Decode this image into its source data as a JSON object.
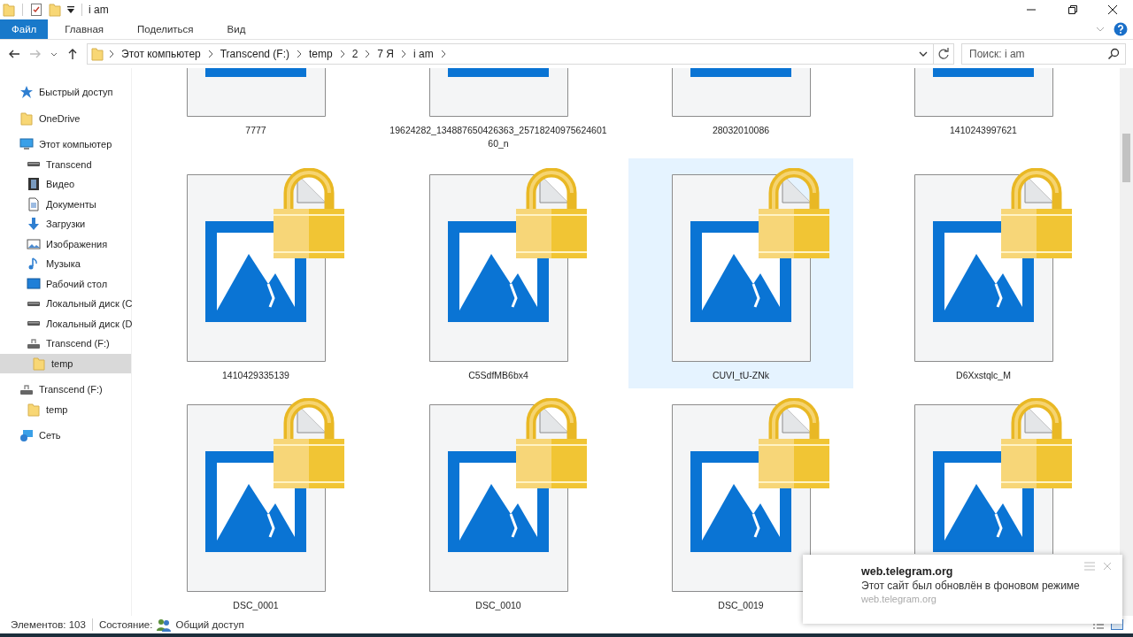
{
  "window": {
    "title": "i am"
  },
  "ribbon_tabs": [
    {
      "label": "Файл",
      "kind": "file",
      "selected": true
    },
    {
      "label": "Главная",
      "kind": "tab",
      "selected": false
    },
    {
      "label": "Поделиться",
      "kind": "tab",
      "selected": false
    },
    {
      "label": "Вид",
      "kind": "tab",
      "selected": false
    }
  ],
  "address": {
    "path": [
      "Этот компьютер",
      "Transcend (F:)",
      "temp",
      "2",
      "7 Я",
      "i am"
    ]
  },
  "search": {
    "placeholder": "Поиск: i am"
  },
  "sidebar": {
    "items": [
      {
        "label": "Быстрый доступ",
        "kind": "star",
        "selected": false
      },
      {
        "label": "OneDrive",
        "kind": "folder",
        "selected": false
      },
      {
        "label": "Этот компьютер",
        "kind": "computer",
        "selected": false,
        "children": [
          {
            "label": "Transcend",
            "kind": "drive",
            "selected": false
          },
          {
            "label": "Видео",
            "kind": "video",
            "selected": false
          },
          {
            "label": "Документы",
            "kind": "documents",
            "selected": false
          },
          {
            "label": "Загрузки",
            "kind": "downloads",
            "selected": false
          },
          {
            "label": "Изображения",
            "kind": "pictures",
            "selected": false
          },
          {
            "label": "Музыка",
            "kind": "music",
            "selected": false
          },
          {
            "label": "Рабочий стол",
            "kind": "desktop",
            "selected": false
          },
          {
            "label": "Локальный диск (C",
            "kind": "drive",
            "selected": false
          },
          {
            "label": "Локальный диск (D",
            "kind": "drive",
            "selected": false
          },
          {
            "label": "Transcend (F:)",
            "kind": "usb",
            "selected": false,
            "children": [
              {
                "label": "temp",
                "kind": "folder",
                "selected": true
              }
            ]
          }
        ]
      },
      {
        "label": "Transcend (F:)",
        "kind": "usb",
        "selected": false,
        "children": [
          {
            "label": "temp",
            "kind": "folder",
            "selected": false
          }
        ]
      },
      {
        "label": "Сеть",
        "kind": "network",
        "selected": false
      }
    ]
  },
  "files": [
    {
      "name": "7777",
      "selected": false
    },
    {
      "name": "19624282_134887650426363_2571824097562460160_n",
      "selected": false
    },
    {
      "name": "28032010086",
      "selected": false
    },
    {
      "name": "1410243997621",
      "selected": false
    },
    {
      "name": "1410429335139",
      "locked": true,
      "selected": false
    },
    {
      "name": "C5SdfMB6bx4",
      "locked": true,
      "selected": false
    },
    {
      "name": "CUVI_tU-ZNk",
      "locked": true,
      "selected": true
    },
    {
      "name": "D6Xxstqlc_M",
      "locked": true,
      "selected": false
    },
    {
      "name": "DSC_0001",
      "locked": true,
      "selected": false
    },
    {
      "name": "DSC_0010",
      "locked": true,
      "selected": false
    },
    {
      "name": "DSC_0019",
      "locked": true,
      "selected": false
    },
    {
      "locked": true,
      "selected": false
    }
  ],
  "status_bar": {
    "count": "Элементов: 103",
    "state_label": "Состояние:",
    "state_value": "Общий доступ"
  },
  "notification": {
    "title": "web.telegram.org",
    "message": "Этот сайт был обновлён в фоновом режиме",
    "source": "web.telegram.org"
  }
}
